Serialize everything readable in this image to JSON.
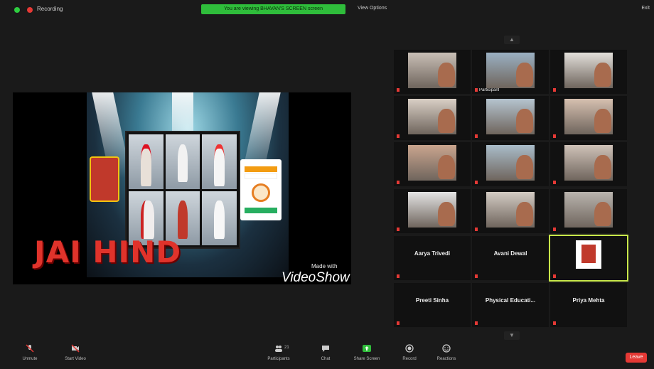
{
  "topbar": {
    "recording_label": "Recording",
    "banner_text": "You are viewing BHAVAN'S SCREEN screen",
    "view_options": "View Options",
    "fullscreen": "Exit"
  },
  "shared_screen": {
    "headline": "JAI HIND",
    "made_with": "Made with",
    "brand": "VideoShow"
  },
  "gallery": {
    "tiles": [
      {
        "name": "",
        "kind": "video"
      },
      {
        "name": "Participant",
        "kind": "video"
      },
      {
        "name": "",
        "kind": "video"
      },
      {
        "name": "",
        "kind": "video"
      },
      {
        "name": "",
        "kind": "video"
      },
      {
        "name": "",
        "kind": "video"
      },
      {
        "name": "",
        "kind": "video"
      },
      {
        "name": "",
        "kind": "video"
      },
      {
        "name": "",
        "kind": "video"
      },
      {
        "name": "",
        "kind": "video"
      },
      {
        "name": "",
        "kind": "video"
      },
      {
        "name": "",
        "kind": "video"
      },
      {
        "name": "",
        "big": "Aarya Trivedi",
        "kind": "name"
      },
      {
        "name": "",
        "big": "Avani Dewal",
        "kind": "name"
      },
      {
        "name": "",
        "kind": "active"
      },
      {
        "name": "",
        "big": "Preeti Sinha",
        "kind": "name"
      },
      {
        "name": "",
        "big": "Physical Educati...",
        "kind": "name"
      },
      {
        "name": "",
        "big": "Priya Mehta",
        "kind": "name"
      }
    ]
  },
  "toolbar": {
    "unmute": "Unmute",
    "start_video": "Start Video",
    "participants": "Participants",
    "participants_count": "21",
    "chat": "Chat",
    "share_screen": "Share Screen",
    "record": "Record",
    "reactions": "Reactions",
    "leave": "Leave"
  },
  "colors": {
    "banner": "#2fbd3b",
    "leave": "#e53935",
    "active_speaker": "#c8e84a",
    "headline": "#e0332b"
  }
}
